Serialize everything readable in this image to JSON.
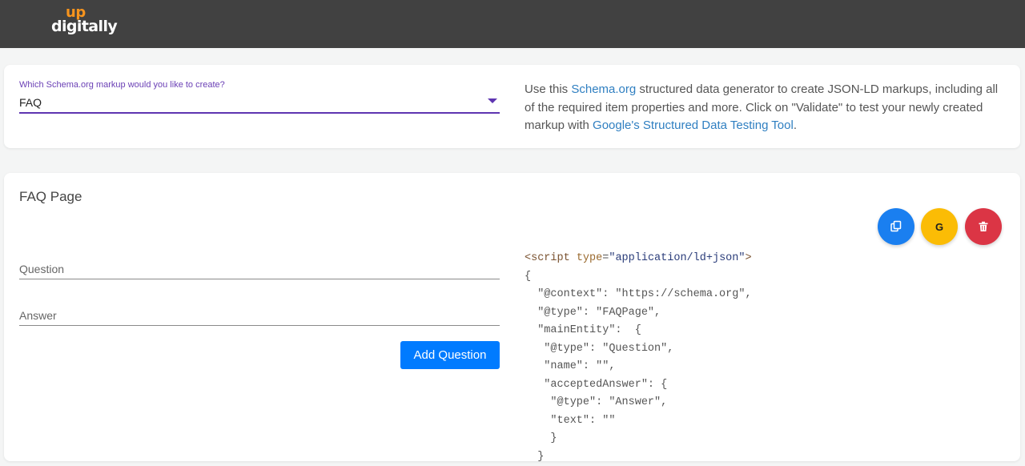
{
  "header": {
    "logo_top": "up",
    "logo_main": "digitally"
  },
  "selector": {
    "label": "Which Schema.org markup would you like to create?",
    "value": "FAQ",
    "accent_color": "#5e35b1"
  },
  "intro": {
    "part1": "Use this ",
    "link1": "Schema.org",
    "part2": " structured data generator to create JSON-LD markups, including all of the required item properties and more. Click on \"Validate\" to test your newly created markup with ",
    "link2": "Google's Structured Data Testing Tool",
    "part3": "."
  },
  "faq": {
    "title": "FAQ Page",
    "question_placeholder": "Question",
    "answer_placeholder": "Answer",
    "add_button": "Add Question"
  },
  "actions": {
    "copy_icon": "copy-icon",
    "google_label": "G",
    "delete_icon": "trash-icon"
  },
  "code": {
    "tag_open": "<script",
    "attr_name": "type",
    "attr_eq": "=",
    "attr_value": "\"application/ld+json\"",
    "tag_close": ">",
    "lines": [
      "{",
      "  \"@context\": \"https://schema.org\",",
      "  \"@type\": \"FAQPage\",",
      "  \"mainEntity\":  {",
      "   \"@type\": \"Question\",",
      "   \"name\": \"\",",
      "   \"acceptedAnswer\": {",
      "    \"@type\": \"Answer\",",
      "    \"text\": \"\"",
      "    }",
      "  }"
    ]
  }
}
